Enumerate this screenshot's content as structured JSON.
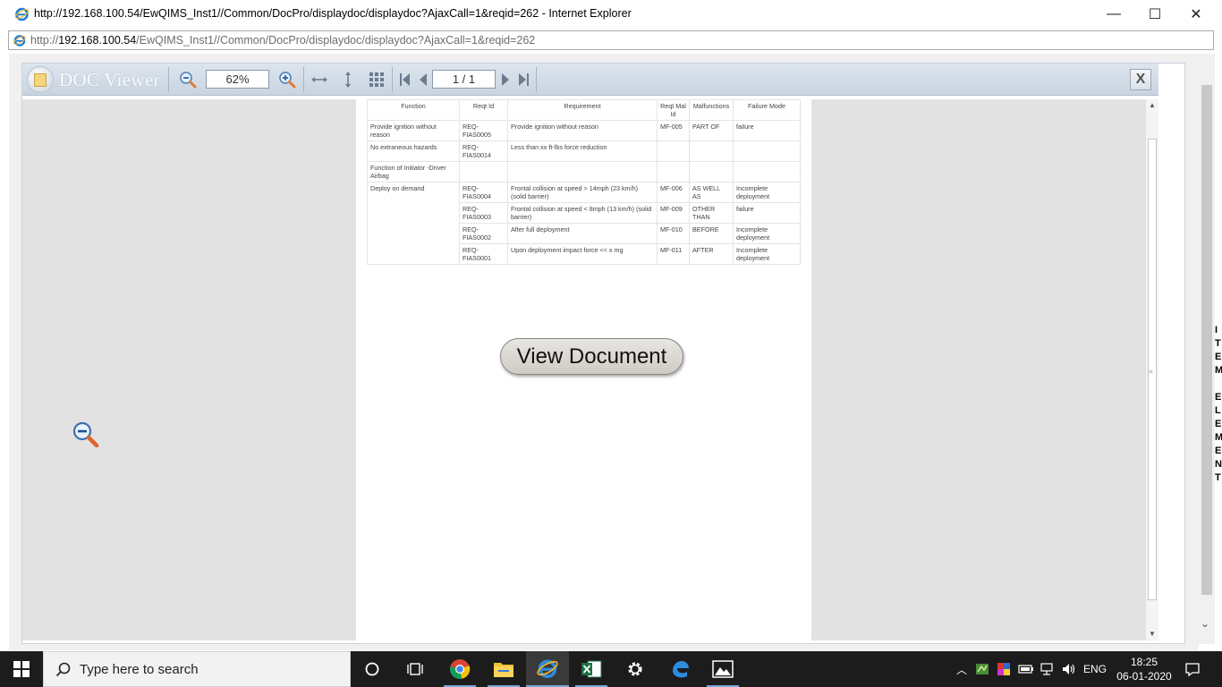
{
  "window": {
    "title": "http://192.168.100.54/EwQIMS_Inst1//Common/DocPro/displaydoc/displaydoc?AjaxCall=1&reqid=262 - Internet Explorer",
    "minimize_label": "—",
    "maximize_label": "☐",
    "close_label": "✕"
  },
  "address": {
    "prefix": "http://",
    "host": "192.168.100.54",
    "path": "/EwQIMS_Inst1//Common/DocPro/displaydoc/displaydoc?AjaxCall=1&reqid=262"
  },
  "viewer": {
    "app_name": "DOC Viewer",
    "zoom_value": "62%",
    "page_value": "1 / 1",
    "close_label": "X",
    "view_document_label": "View Document"
  },
  "table": {
    "headers": [
      "Function",
      "Reqt Id",
      "Requirement",
      "Reqt Mal Id",
      "Malfunctions",
      "Failure Mode"
    ],
    "rows": [
      {
        "function": "Provide ignition without reason",
        "req_id": "REQ-FIAS0005",
        "requirement": "Provide ignition without reason",
        "mal_id": "MF-005",
        "malfunction": "PART OF",
        "failure": "failure"
      },
      {
        "function": "No extraneous hazards",
        "req_id": "REQ-FIAS0014",
        "requirement": "Less than xx ft-lbs force reduction",
        "mal_id": "",
        "malfunction": "",
        "failure": ""
      },
      {
        "function": "Function of Initiator -Driver Airbag",
        "req_id": "",
        "requirement": "",
        "mal_id": "",
        "malfunction": "",
        "failure": ""
      },
      {
        "function": "Deploy on demand",
        "req_id": "REQ-FIAS0004",
        "requirement": "Frontal collision at speed > 14mph (23 km/h) (solid barrier)",
        "mal_id": "MF-006",
        "malfunction": "AS WELL AS",
        "failure": "Incomplete deployment"
      },
      {
        "function": "",
        "req_id": "REQ-FIAS0003",
        "requirement": "Frontal collision at speed < 8mph (13 km/h) (solid barrier)",
        "mal_id": "MF-009",
        "malfunction": "OTHER THAN",
        "failure": "failure"
      },
      {
        "function": "",
        "req_id": "REQ-FIAS0002",
        "requirement": "After full deployment",
        "mal_id": "MF-010",
        "malfunction": "BEFORE",
        "failure": "Incomplete deployment"
      },
      {
        "function": "",
        "req_id": "REQ-FIAS0001",
        "requirement": "Upon deployment impact force << x mg",
        "mal_id": "MF-011",
        "malfunction": "AFTER",
        "failure": "Incomplete deployment"
      }
    ]
  },
  "page_side_letters": "I\nT\nE\nM\n\nE\nL\nE\nM\nE\nN\nT",
  "taskbar": {
    "search_placeholder": "Type here to search",
    "language": "ENG",
    "time": "18:25",
    "date": "06-01-2020"
  },
  "icons": [
    "ie-icon",
    "zoom-out-icon",
    "zoom-in-icon",
    "fit-width-icon",
    "fit-height-icon",
    "thumbnails-icon",
    "first-page-icon",
    "prev-page-icon",
    "next-page-icon",
    "last-page-icon",
    "windows-start-icon",
    "search-icon",
    "cortana-icon",
    "task-view-icon",
    "chrome-icon",
    "file-explorer-icon",
    "excel-icon",
    "settings-icon",
    "edge-icon",
    "photos-icon"
  ],
  "colors": {
    "toolbar_top": "#dde5ee",
    "toolbar_bottom": "#c8d4e0",
    "viewer_gutter": "#e2e2e2",
    "taskbar": "#1c1c1c",
    "ie_blue": "#1e7ed6"
  }
}
